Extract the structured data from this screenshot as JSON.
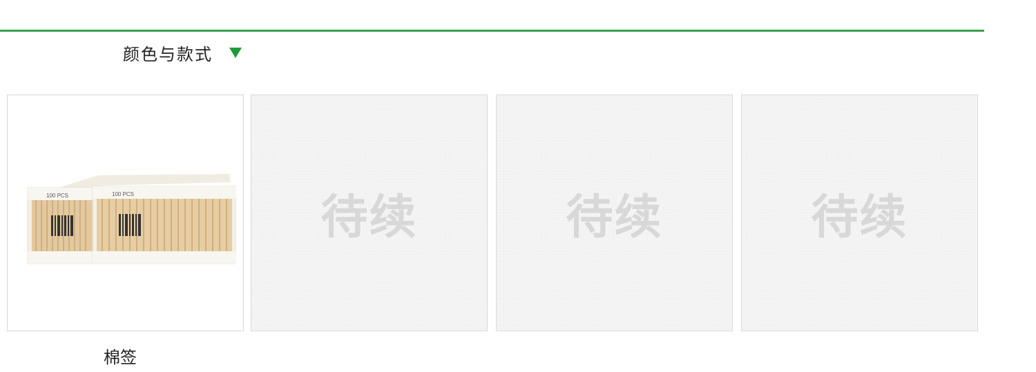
{
  "section": {
    "title": "颜色与款式",
    "arrow_icon": "triangle-down-icon",
    "accent_color": "#1c9b3a",
    "divider_color": "#3aa04a"
  },
  "items": [
    {
      "label": "棉签",
      "image": "cotton-swab-pack-image",
      "pack_text": "100 PCS"
    },
    {
      "placeholder": "待续"
    },
    {
      "placeholder": "待续"
    },
    {
      "placeholder": "待续"
    }
  ]
}
